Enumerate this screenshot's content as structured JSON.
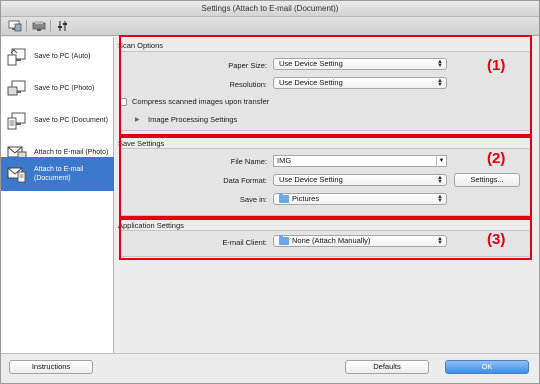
{
  "window": {
    "title": "Settings (Attach to E-mail (Document))"
  },
  "toolbar": {
    "tab_icons": [
      "scan-from-computer-icon",
      "scan-from-operation-panel-icon",
      "general-settings-icon"
    ]
  },
  "sidebar": {
    "items": [
      {
        "label": "Save to PC (Auto)",
        "icon": "save-to-pc-auto-icon"
      },
      {
        "label": "Save to PC (Photo)",
        "icon": "save-to-pc-photo-icon"
      },
      {
        "label": "Save to PC (Document)",
        "icon": "save-to-pc-document-icon"
      },
      {
        "label": "Attach to E-mail (Photo)",
        "icon": "attach-email-photo-icon"
      },
      {
        "label": "Attach to E-mail (Document)",
        "icon": "attach-email-document-icon",
        "selected": true
      }
    ]
  },
  "scan_options": {
    "title": "Scan Options",
    "paper_size_label": "Paper Size:",
    "paper_size_value": "Use Device Setting",
    "resolution_label": "Resolution:",
    "resolution_value": "Use Device Setting",
    "compress_label": "Compress scanned images upon transfer",
    "compress_checked": false,
    "image_processing_label": "Image Processing Settings",
    "callout": "(1)"
  },
  "save_settings": {
    "title": "Save Settings",
    "file_name_label": "File Name:",
    "file_name_value": "IMG",
    "data_format_label": "Data Format:",
    "data_format_value": "Use Device Setting",
    "settings_button": "Settings...",
    "save_in_label": "Save in:",
    "save_in_value": "Pictures",
    "callout": "(2)"
  },
  "application_settings": {
    "title": "Application Settings",
    "email_client_label": "E-mail Client:",
    "email_client_value": "None (Attach Manually)",
    "callout": "(3)"
  },
  "footer": {
    "instructions_button": "Instructions",
    "defaults_button": "Defaults",
    "ok_button": "OK"
  },
  "colors": {
    "accent": "#3c79cc",
    "callout_red": "#e40013",
    "ok_blue": "#3f8ee8"
  }
}
